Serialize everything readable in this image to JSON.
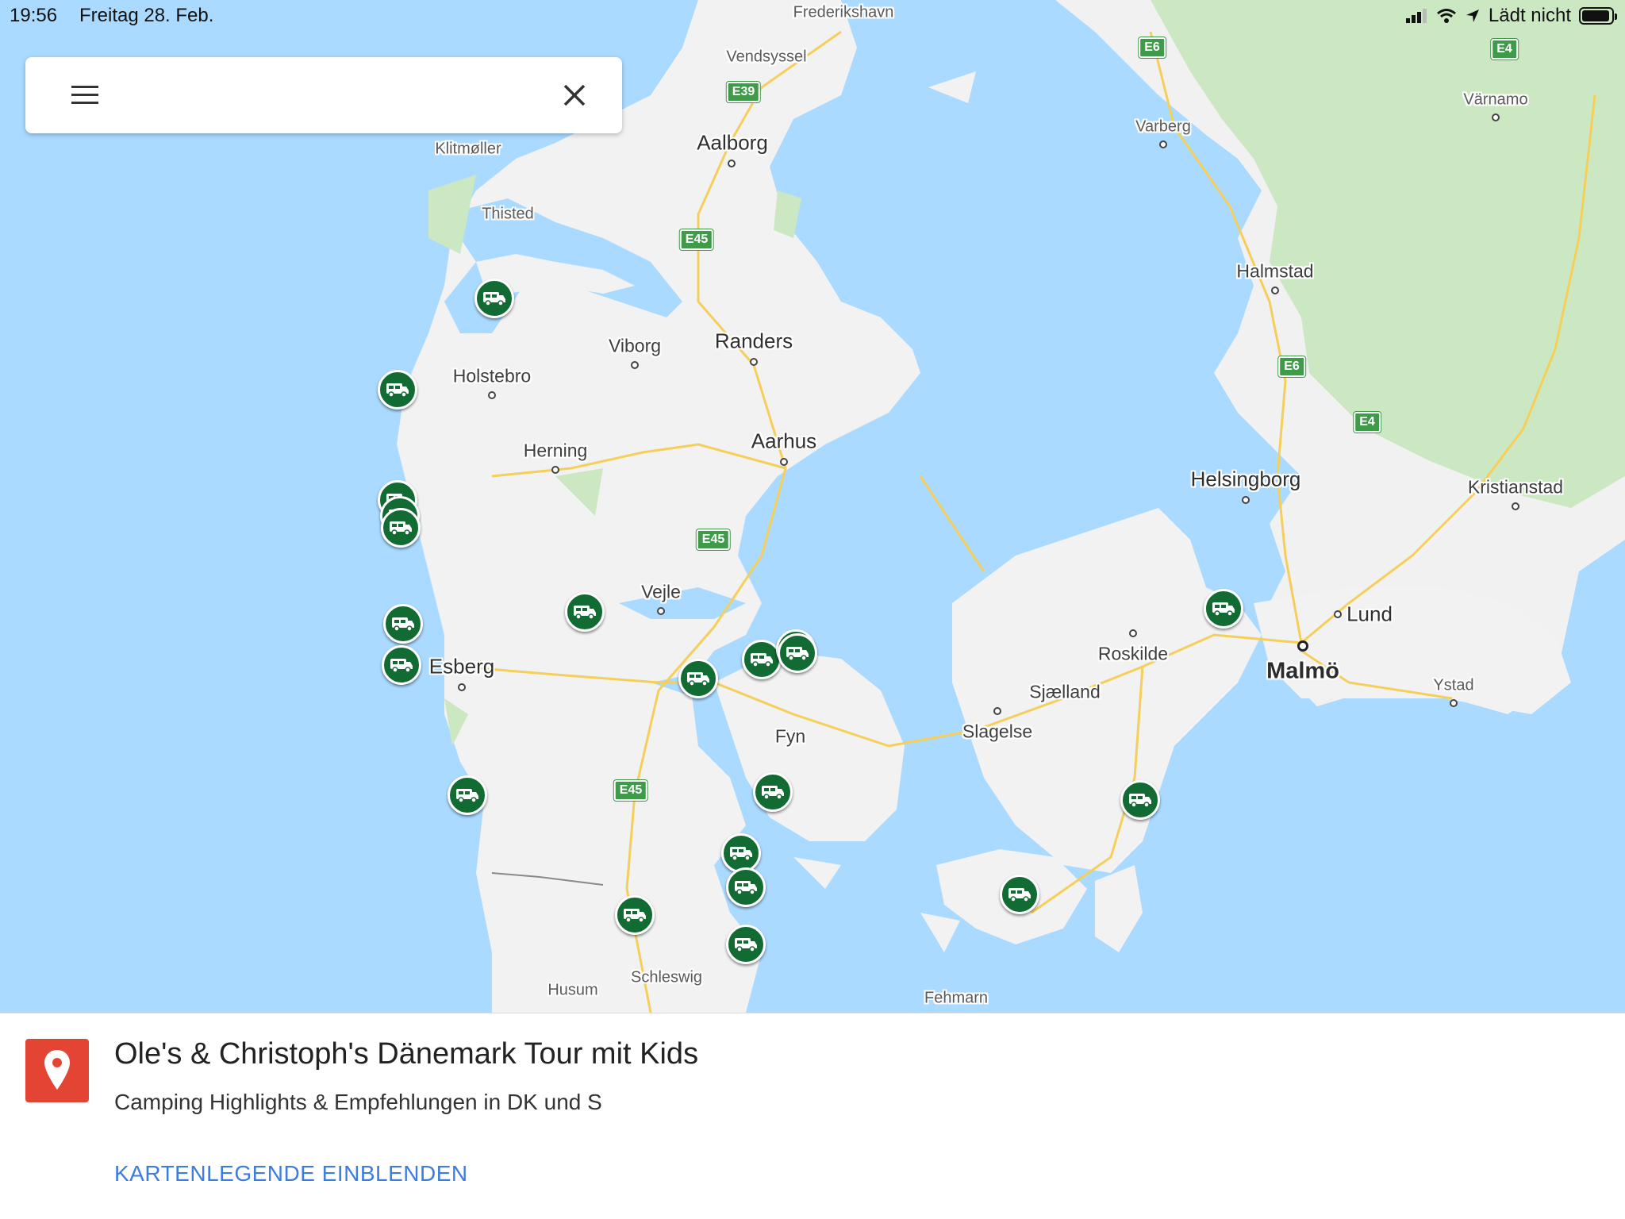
{
  "status_bar": {
    "time": "19:56",
    "date": "Freitag 28. Feb.",
    "charging": "Lädt nicht",
    "battery_level": 0.95
  },
  "search": {
    "value": "",
    "placeholder": "",
    "menu_icon": "hamburger-menu-icon",
    "clear_icon": "close-icon"
  },
  "map": {
    "places": [
      {
        "name": "Frederikshavn"
      },
      {
        "name": "Vendsyssel"
      },
      {
        "name": "Aalborg"
      },
      {
        "name": "Klitmøller"
      },
      {
        "name": "Thisted"
      },
      {
        "name": "Viborg"
      },
      {
        "name": "Randers"
      },
      {
        "name": "Holstebro"
      },
      {
        "name": "Herning"
      },
      {
        "name": "Aarhus"
      },
      {
        "name": "Vejle"
      },
      {
        "name": "Esberg"
      },
      {
        "name": "Fyn"
      },
      {
        "name": "Husum"
      },
      {
        "name": "Schleswig"
      },
      {
        "name": "Fehmarn"
      },
      {
        "name": "Roskilde"
      },
      {
        "name": "Sjælland"
      },
      {
        "name": "Slagelse"
      },
      {
        "name": "Malmö"
      },
      {
        "name": "Lund"
      },
      {
        "name": "Ystad"
      },
      {
        "name": "Helsingborg"
      },
      {
        "name": "Kristianstad"
      },
      {
        "name": "Halmstad"
      },
      {
        "name": "Varberg"
      },
      {
        "name": "Värnamo"
      }
    ],
    "road_shields": [
      "E39",
      "E45",
      "E45",
      "E45",
      "E6",
      "E6",
      "E4",
      "E4"
    ],
    "marker_icon": "camper-van-icon",
    "marker_count": 22
  },
  "sheet": {
    "title": "Ole's & Christoph's Dänemark Tour mit Kids",
    "subtitle": "Camping Highlights & Empfehlungen in DK und S",
    "legend_link": "KARTENLEGENDE EINBLENDEN",
    "icon": "map-pin-icon"
  },
  "colors": {
    "water": "#aadaff",
    "land": "#f2f2f2",
    "forest": "#c9e7c0",
    "marker": "#126b32",
    "link": "#3b7de0",
    "map_icon_bg": "#e44434"
  }
}
